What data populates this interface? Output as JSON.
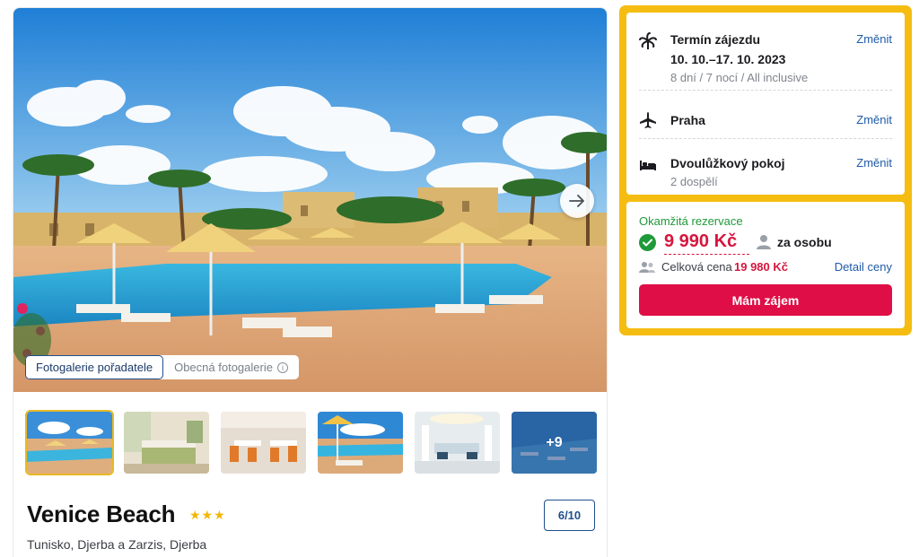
{
  "gallery": {
    "tabs": [
      {
        "label": "Fotogalerie pořadatele",
        "active": true
      },
      {
        "label": "Obecná fotogalerie",
        "active": false
      }
    ],
    "info_icon_glyph": "i",
    "next_icon": "arrow-right-icon",
    "more_photos_label": "+9",
    "thumbnails": [
      "pool",
      "room",
      "restaurant",
      "pool-umbrellas",
      "lobby",
      "more"
    ]
  },
  "hotel": {
    "name": "Venice Beach",
    "stars": "★★★",
    "location": "Tunisko, Djerba a Zarzis, Djerba",
    "rating": "6/10"
  },
  "booking": {
    "term": {
      "icon": "palm-icon",
      "title": "Termín zájezdu",
      "dates": "10. 10.–17. 10. 2023",
      "details": "8 dní / 7 nocí / All inclusive",
      "change_label": "Změnit"
    },
    "departure": {
      "icon": "plane-icon",
      "title": "Praha",
      "change_label": "Změnit"
    },
    "room": {
      "icon": "bed-icon",
      "title": "Dvoulůžkový pokoj",
      "occupants": "2 dospělí",
      "change_label": "Změnit"
    },
    "price": {
      "instant_label": "Okamžitá rezervace",
      "per_person_price": "9 990 Kč",
      "per_person_label": "za osobu",
      "total_label": "Celková cena",
      "total_value": "19 980 Kč",
      "detail_link": "Detail ceny",
      "cta_label": "Mám zájem"
    }
  },
  "colors": {
    "accent_yellow": "#f5bd12",
    "price_red": "#d6163e",
    "cta_red": "#df0e46",
    "link_blue": "#1f5aa8",
    "success_green": "#1f9a3a",
    "star_gold": "#f2b705"
  }
}
